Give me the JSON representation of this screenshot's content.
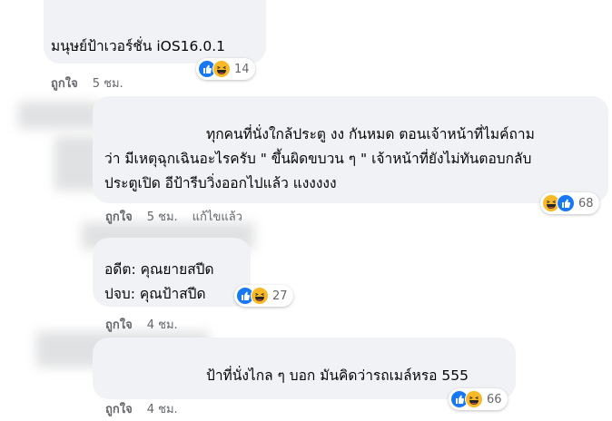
{
  "comments": [
    {
      "lines": [
        "มนุษย์ป้าเวอร์ชั่น iOS16.0.1"
      ],
      "like_label": "ถูกใจ",
      "time": "5 ชม.",
      "reaction_count": "14",
      "reactions": [
        "like-icon",
        "haha-icon"
      ]
    },
    {
      "lines": [
        "ทุกคนที่นั่งใกล้ประตู งง กันหมด ตอนเจ้าหน้าที่ไมค์ถาม",
        "ว่า มีเหตุฉุกเฉินอะไรครับ \" ขึ้นผิดขบวน ๆ \" เจ้าหน้าที่ยังไม่ทันตอบกลับ",
        "ประตูเปิด อีป้ารีบวิ่งออกไปแล้ว แงงงงง"
      ],
      "like_label": "ถูกใจ",
      "time": "5 ชม.",
      "edited_label": "แก้ไขแล้ว",
      "reaction_count": "68",
      "reactions": [
        "haha-icon",
        "like-icon"
      ]
    },
    {
      "lines": [
        "อดีต: คุณยายสปีด",
        "ปจบ: คุณป้าสปีด"
      ],
      "like_label": "ถูกใจ",
      "time": "4 ชม.",
      "reaction_count": "27",
      "reactions": [
        "like-icon",
        "haha-icon"
      ]
    },
    {
      "lines": [
        "ป้าที่นั่งไกล ๆ บอก มันคิดว่ารถเมล์หรอ 555"
      ],
      "like_label": "ถูกใจ",
      "time": "4 ชม.",
      "reaction_count": "66",
      "reactions": [
        "like-icon",
        "haha-icon"
      ]
    }
  ],
  "colors": {
    "bubble": "#f0f2f5",
    "meta_text": "#65676b",
    "like_blue": "#1877f2",
    "haha_yellow": "#f7b928"
  }
}
